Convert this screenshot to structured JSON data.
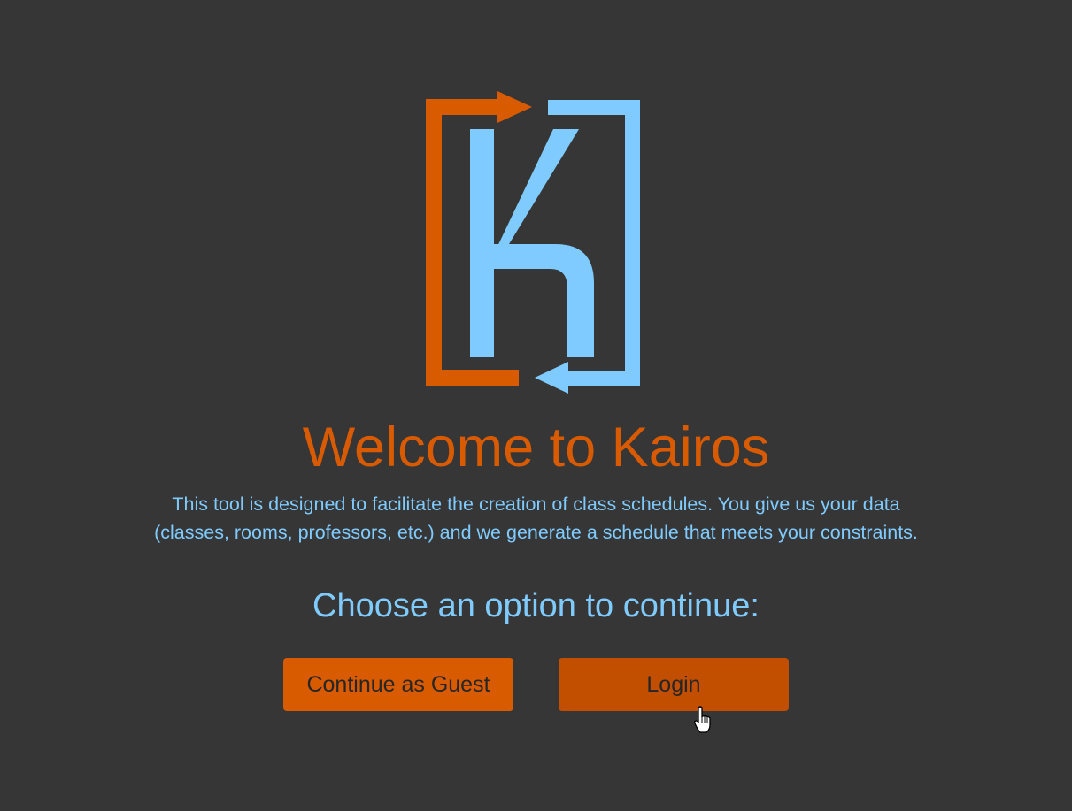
{
  "colors": {
    "background": "#363636",
    "orange": "#d95b00",
    "orange_hover": "#c24e00",
    "light_blue": "#7fcbff",
    "button_text": "#262626"
  },
  "logo": {
    "letter_icon": "kairos-k-logo-icon"
  },
  "welcome": {
    "title": "Welcome to Kairos",
    "description_line1": "This tool is designed to facilitate the creation of class schedules. You give us your data",
    "description_line2": "(classes, rooms, professors, etc.) and we generate a schedule that meets your constraints."
  },
  "options": {
    "prompt": "Choose an option to continue:",
    "guest_label": "Continue as Guest",
    "login_label": "Login"
  },
  "cursor": {
    "icon": "hand-pointer-cursor-icon"
  }
}
